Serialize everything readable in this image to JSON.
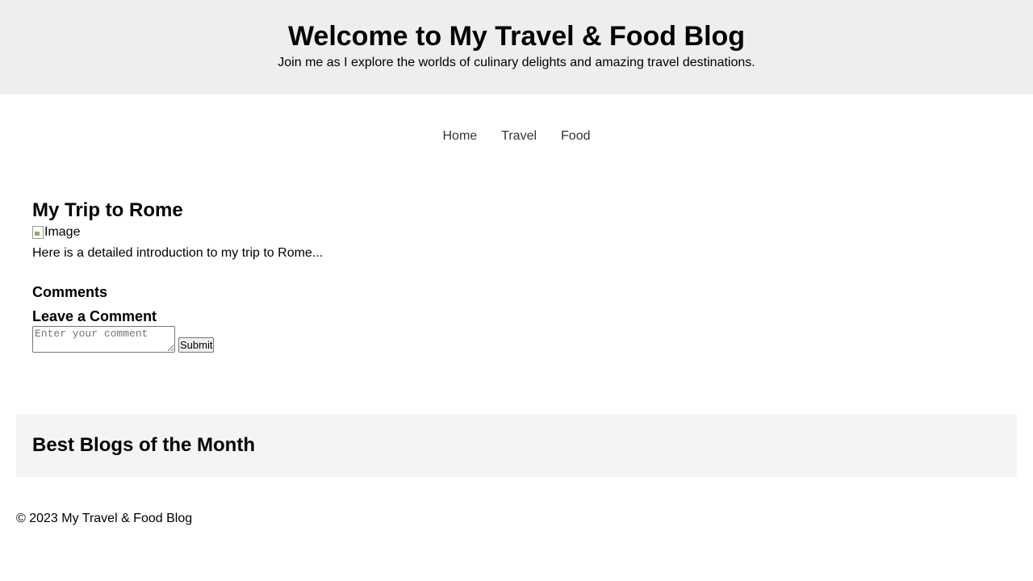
{
  "header": {
    "title": "Welcome to My Travel & Food Blog",
    "subtitle": "Join me as I explore the worlds of culinary delights and amazing travel destinations."
  },
  "nav": {
    "items": [
      {
        "label": "Home"
      },
      {
        "label": "Travel"
      },
      {
        "label": "Food"
      }
    ]
  },
  "post": {
    "title": "My Trip to Rome",
    "image_alt": "Image",
    "intro": "Here is a detailed introduction to my trip to Rome...",
    "comments_heading": "Comments",
    "leave_comment_heading": "Leave a Comment",
    "comment_placeholder": "Enter your comment",
    "submit_label": "Submit"
  },
  "best_blogs": {
    "heading": "Best Blogs of the Month"
  },
  "footer": {
    "text": "© 2023 My Travel & Food Blog"
  },
  "colors": {
    "header_bg": "#eeeeee",
    "nav_link": "#333333",
    "best_blogs_bg": "#f4f4f4"
  }
}
